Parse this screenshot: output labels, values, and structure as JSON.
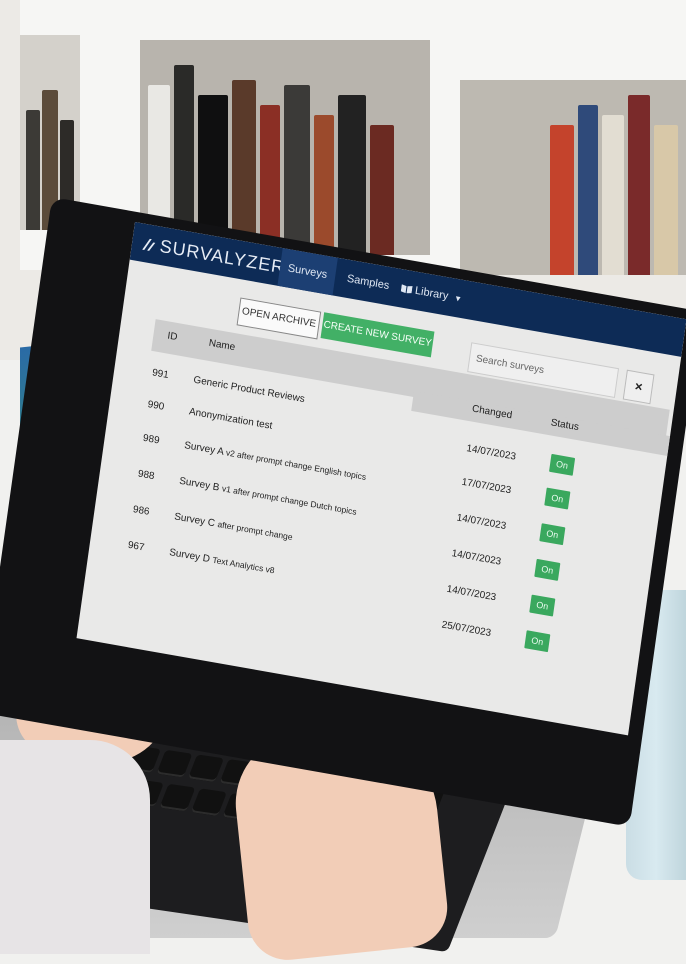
{
  "app": {
    "brand": "SURVALYZER"
  },
  "nav": {
    "tabs": [
      {
        "label": "Surveys",
        "active": true
      },
      {
        "label": "Samples",
        "active": false
      },
      {
        "label": "Library",
        "active": false,
        "icon": "book-icon",
        "dropdown": true
      }
    ]
  },
  "toolbar": {
    "open_archive_label": "OPEN ARCHIVE",
    "create_survey_label": "CREATE NEW SURVEY",
    "search_placeholder": "Search surveys",
    "clear_label": "×"
  },
  "table": {
    "columns": {
      "id": "ID",
      "name": "Name",
      "changed": "Changed",
      "status": "Status"
    },
    "rows": [
      {
        "id": "991",
        "name": "Generic Product Reviews",
        "changed": "14/07/2023",
        "status": "On"
      },
      {
        "id": "990",
        "name": "Anonymization test",
        "changed": "17/07/2023",
        "status": "On"
      },
      {
        "id": "989",
        "name": "Survey A",
        "name_sub": "v2 after prompt change English topics",
        "changed": "14/07/2023",
        "status": "On"
      },
      {
        "id": "988",
        "name": "Survey B",
        "name_sub": "v1 after prompt change Dutch topics",
        "changed": "14/07/2023",
        "status": "On"
      },
      {
        "id": "986",
        "name": "Survey C",
        "name_sub": "after prompt change",
        "changed": "14/07/2023",
        "status": "On"
      },
      {
        "id": "967",
        "name": "Survey D",
        "name_sub": "Text Analytics v8",
        "changed": "25/07/2023",
        "status": "On"
      }
    ]
  },
  "colors": {
    "navbar": "#0d2b56",
    "accent_green": "#42b066",
    "status_green": "#3aa85e"
  }
}
